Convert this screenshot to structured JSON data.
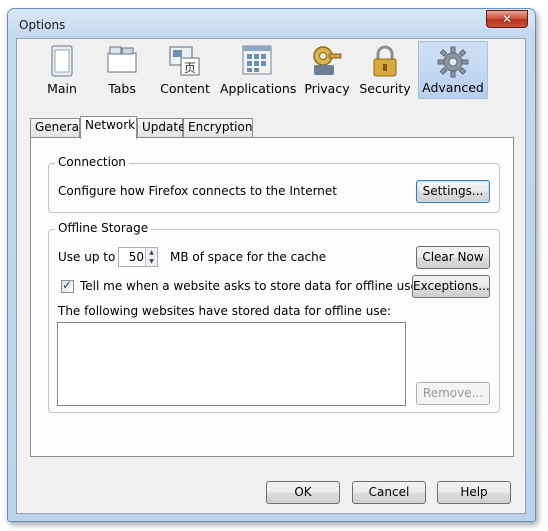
{
  "window": {
    "title": "Options",
    "close_glyph": "✕"
  },
  "toolbar": {
    "items": [
      {
        "label": "Main",
        "icon": "main-icon"
      },
      {
        "label": "Tabs",
        "icon": "tabs-icon"
      },
      {
        "label": "Content",
        "icon": "content-icon"
      },
      {
        "label": "Applications",
        "icon": "applications-icon"
      },
      {
        "label": "Privacy",
        "icon": "privacy-icon"
      },
      {
        "label": "Security",
        "icon": "security-icon"
      },
      {
        "label": "Advanced",
        "icon": "advanced-icon",
        "selected": true
      }
    ]
  },
  "tabs": [
    {
      "label": "General"
    },
    {
      "label": "Network",
      "active": true
    },
    {
      "label": "Update"
    },
    {
      "label": "Encryption"
    }
  ],
  "connection": {
    "title": "Connection",
    "description": "Configure how Firefox connects to the Internet",
    "settings_button": "Settings..."
  },
  "offline": {
    "title": "Offline Storage",
    "use_up_to": "Use up to",
    "cache_value": "50",
    "cache_suffix": "MB of space for the cache",
    "clear_now_button": "Clear Now",
    "tell_me_label": "Tell me when a website asks to store data for offline use",
    "tell_me_checked": true,
    "exceptions_button": "Exceptions...",
    "stored_label": "The following websites have stored data for offline use:",
    "remove_button": "Remove..."
  },
  "footer": {
    "ok": "OK",
    "cancel": "Cancel",
    "help": "Help"
  },
  "colors": {
    "selected_toolbar_bg": "#b8d0ee",
    "close_button": "#c9513a",
    "checkmark": "#2b4b7a"
  }
}
